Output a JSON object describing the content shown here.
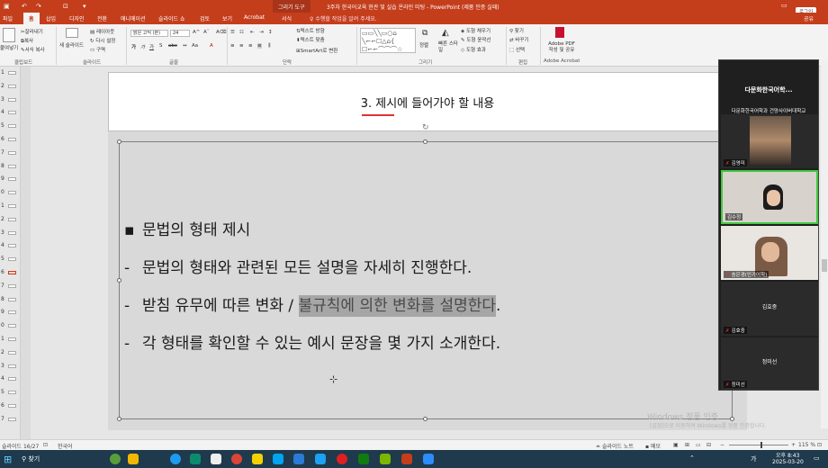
{
  "titlebar": {
    "context_tab": "그리기 도구",
    "document_title": "3주차 한국어교육 현관 및 실습 온라인 미팅 - PowerPoint (제품 인증 실패)",
    "login": "로그인"
  },
  "tabs": {
    "file": "파일",
    "home": "홈",
    "insert": "삽입",
    "design": "디자인",
    "transitions": "전환",
    "animations": "애니메이션",
    "slideshow": "슬라이드 쇼",
    "review": "검토",
    "view": "보기",
    "acrobat": "Acrobat",
    "format": "서식",
    "tell_me": "수행할 작업을 알려 주세요.",
    "share": "공유"
  },
  "ribbon": {
    "paste": "붙여넣기",
    "cut": "잘라내기",
    "copy": "복사",
    "format_painter": "서식 복사",
    "new_slide": "새 슬라이드",
    "layout": "레이아웃",
    "reset": "다시 설정",
    "section": "구역",
    "font_name": "맑은 고딕 (본)",
    "font_size": "24",
    "text_direction": "텍스트 방향",
    "align_text": "텍스트 맞춤",
    "smartart": "SmartArt로 변환",
    "arrange": "정렬",
    "quick_styles": "빠른 스타일",
    "shape_fill": "도형 채우기",
    "shape_outline": "도형 윤곽선",
    "shape_effects": "도형 효과",
    "find": "찾기",
    "replace": "바꾸기",
    "select": "선택",
    "adobe_pdf": "Adobe PDF 작성 및 공유",
    "groups": {
      "clipboard": "클립보드",
      "slides": "슬라이드",
      "font": "글꼴",
      "paragraph": "단락",
      "drawing": "그리기",
      "editing": "편집",
      "adobe": "Adobe Acrobat"
    }
  },
  "thumbnails": [
    "1",
    "2",
    "3",
    "4",
    "5",
    "6",
    "7",
    "8",
    "9",
    "0",
    "1",
    "2",
    "3",
    "4",
    "5",
    "6",
    "7",
    "8",
    "9",
    "0",
    "1",
    "2",
    "3",
    "4",
    "5",
    "6",
    "7"
  ],
  "slide": {
    "title": "3. 제시에 들어가야 할 내용",
    "lines": [
      {
        "bullet": "▪",
        "text": "문법의 형태 제시"
      },
      {
        "bullet": "-",
        "text": "문법의 형태와 관련된 모든 설명을 자세히 진행한다."
      },
      {
        "bullet": "-",
        "text_before": "받침 유무에 따른 변화 / ",
        "text_highlight": "불규칙에 의한 변화를 설명한다",
        "text_after": "."
      },
      {
        "bullet": "-",
        "text": "각 형태를 확인할 수 있는 예시 문장을 몇 가지 소개한다."
      }
    ]
  },
  "watermark": {
    "line1": "Windows 정품 인증",
    "line2": "[설정]으로 이동하여 Windows를 정품 인증합니다."
  },
  "zoom": {
    "title": "다문화한국어학...",
    "host": "다문화한국어학과 건양사이버대학교",
    "participants": [
      {
        "name": "김영미",
        "video": true
      },
      {
        "name": "김수정",
        "video": true
      },
      {
        "name": "송은경(인가어학)",
        "video": true
      },
      {
        "name": "김효중",
        "video": false,
        "center_label": "김효중"
      },
      {
        "name": "정미선",
        "video": false,
        "center_label": "정미선"
      }
    ]
  },
  "status": {
    "slide_info": "슬라이드 16/27",
    "language": "한국어",
    "notes": "슬라이드 노트",
    "comments": "메모",
    "zoom_level": "115 %"
  },
  "taskbar": {
    "search": "찾기",
    "temperature": "",
    "time": "오후 8:43",
    "date": "2025-03-20",
    "ime": "가"
  },
  "colors": {
    "accent": "#c43e1c",
    "title_underline": "#d33333",
    "highlight": "#a6a6a6"
  }
}
